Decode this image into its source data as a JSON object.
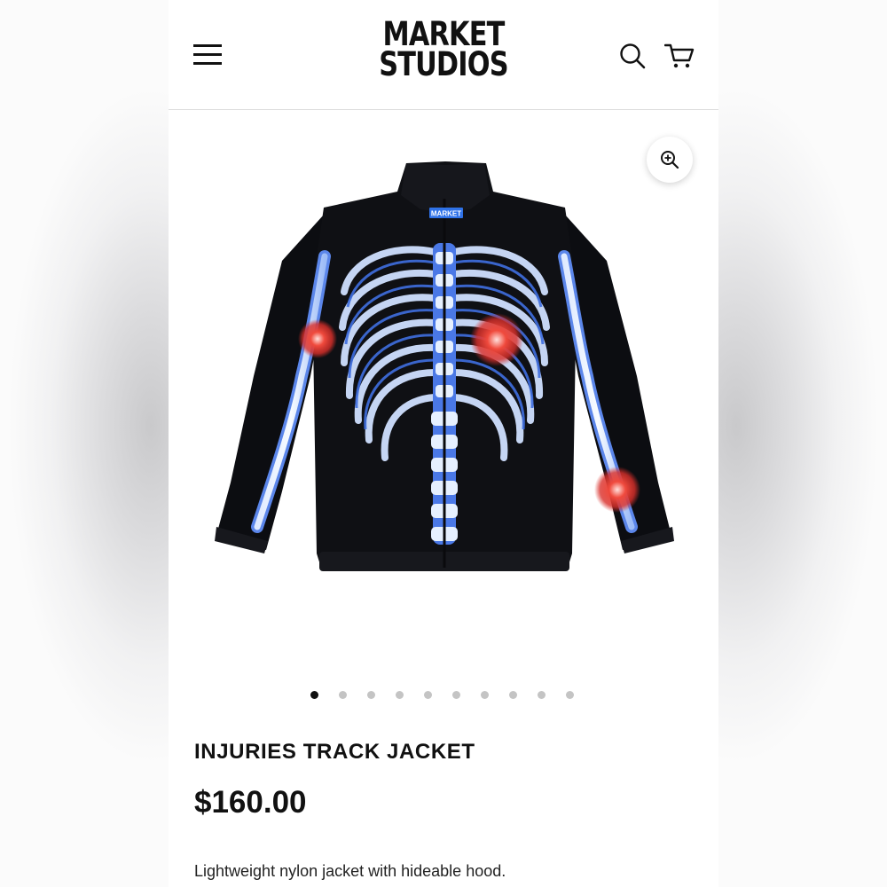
{
  "header": {
    "logo_line1": "MARKET",
    "logo_line2": "STUDIOS",
    "menu_icon": "hamburger-menu-icon",
    "search_icon": "search-icon",
    "cart_icon": "cart-icon"
  },
  "gallery": {
    "image_name": "skeleton-xray-track-jacket",
    "tag_text": "MARKET",
    "zoom_icon": "zoom-in-icon",
    "slide_count": 10,
    "active_slide": 1
  },
  "product": {
    "title": "INJURIES TRACK JACKET",
    "price": "$160.00",
    "description": "Lightweight nylon jacket with hideable hood."
  },
  "colors": {
    "text": "#111111",
    "jacket": "#0c0d11",
    "bone_blue": "#3f6fe0",
    "bone_light": "#e8f1ff",
    "injury_red": "#e23a35",
    "dot_inactive": "#c4c4c4"
  }
}
